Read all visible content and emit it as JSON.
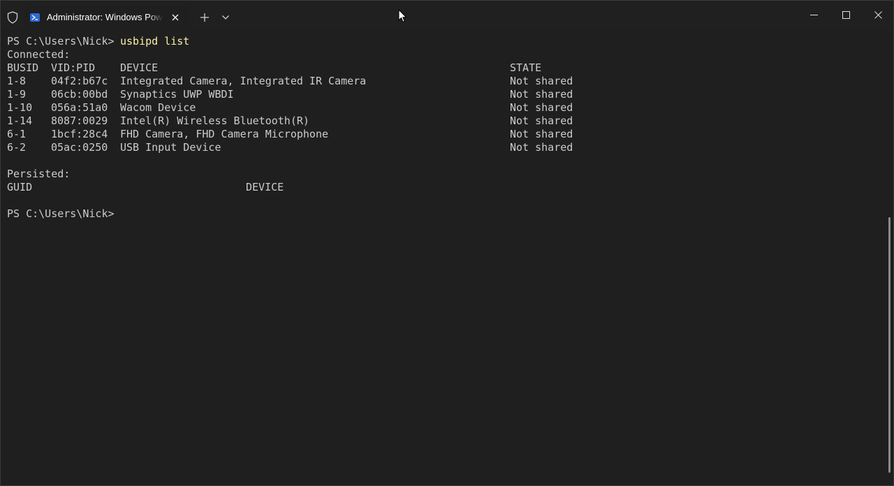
{
  "titlebar": {
    "tab_title": "Administrator: Windows PowerShell",
    "icons": {
      "shield": "shield-icon",
      "tab": "powershell-icon",
      "close_tab": "close-icon",
      "new_tab": "plus-icon",
      "dropdown": "chevron-down-icon",
      "minimize": "minimize-icon",
      "maximize": "maximize-icon",
      "close_window": "close-icon"
    }
  },
  "terminal": {
    "prompt": "PS C:\\Users\\Nick>",
    "command": "usbipd list",
    "connected_label": "Connected:",
    "connected_headers": [
      "BUSID",
      "VID:PID",
      "DEVICE",
      "STATE"
    ],
    "connected_rows": [
      [
        "1-8",
        "04f2:b67c",
        "Integrated Camera, Integrated IR Camera",
        "Not shared"
      ],
      [
        "1-9",
        "06cb:00bd",
        "Synaptics UWP WBDI",
        "Not shared"
      ],
      [
        "1-10",
        "056a:51a0",
        "Wacom Device",
        "Not shared"
      ],
      [
        "1-14",
        "8087:0029",
        "Intel(R) Wireless Bluetooth(R)",
        "Not shared"
      ],
      [
        "6-1",
        "1bcf:28c4",
        "FHD Camera, FHD Camera Microphone",
        "Not shared"
      ],
      [
        "6-2",
        "05ac:0250",
        "USB Input Device",
        "Not shared"
      ]
    ],
    "persisted_label": "Persisted:",
    "persisted_headers": [
      "GUID",
      "DEVICE"
    ],
    "final_prompt": "PS C:\\Users\\Nick>"
  },
  "colors": {
    "background": "#1f1f1f",
    "text": "#cccccc",
    "command": "#f9f1a5",
    "titlebar": "#202020"
  }
}
